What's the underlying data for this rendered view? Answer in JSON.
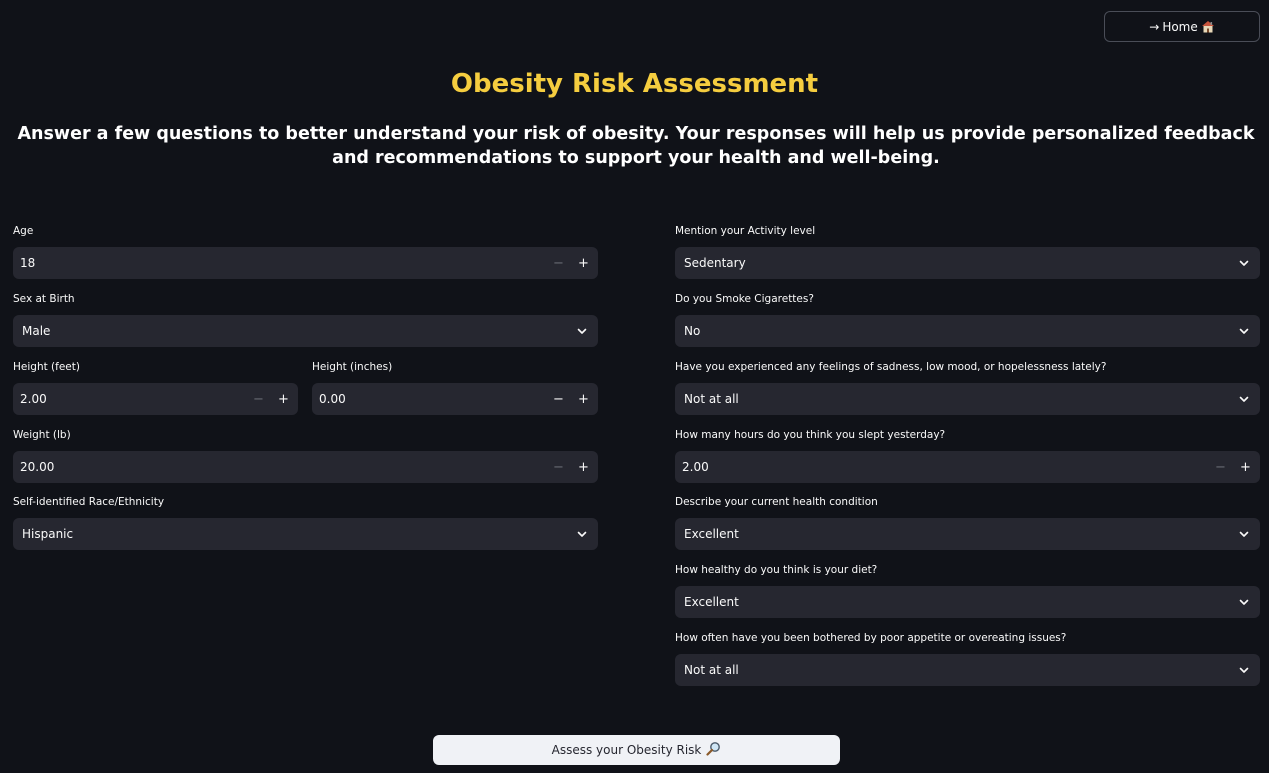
{
  "header": {
    "home_button_arrow": "→",
    "home_button_label": "Home",
    "home_button_icon": "house-icon"
  },
  "title": "Obesity Risk Assessment",
  "subtitle": "Answer a few questions to better understand your risk of obesity. Your responses will help us provide personalized feedback and recommendations to support your health and well-being.",
  "left_form": {
    "age": {
      "label": "Age",
      "value": "18"
    },
    "sex": {
      "label": "Sex at Birth",
      "value": "Male"
    },
    "height_feet": {
      "label": "Height (feet)",
      "value": "2.00"
    },
    "height_inches": {
      "label": "Height (inches)",
      "value": "0.00"
    },
    "weight": {
      "label": "Weight (lb)",
      "value": "20.00"
    },
    "race": {
      "label": "Self-identified Race/Ethnicity",
      "value": "Hispanic"
    }
  },
  "right_form": {
    "activity": {
      "label": "Mention your Activity level",
      "value": "Sedentary"
    },
    "smoke": {
      "label": "Do you Smoke Cigarettes?",
      "value": "No"
    },
    "mood": {
      "label": "Have you experienced any feelings of sadness, low mood, or hopelessness lately?",
      "value": "Not at all"
    },
    "sleep": {
      "label": "How many hours do you think you slept yesterday?",
      "value": "2.00"
    },
    "health": {
      "label": "Describe your current health condition",
      "value": "Excellent"
    },
    "diet": {
      "label": "How healthy do you think is your diet?",
      "value": "Excellent"
    },
    "appetite": {
      "label": "How often have you been bothered by poor appetite or overeating issues?",
      "value": "Not at all"
    }
  },
  "stepper": {
    "minus": "−",
    "plus": "+"
  },
  "assess_button": {
    "label": "Assess your Obesity Risk",
    "icon": "magnifier-icon"
  },
  "colors": {
    "background": "#101218",
    "title": "#f5cd3f",
    "input_bg": "#262730",
    "button_bg": "#f0f2f6"
  }
}
